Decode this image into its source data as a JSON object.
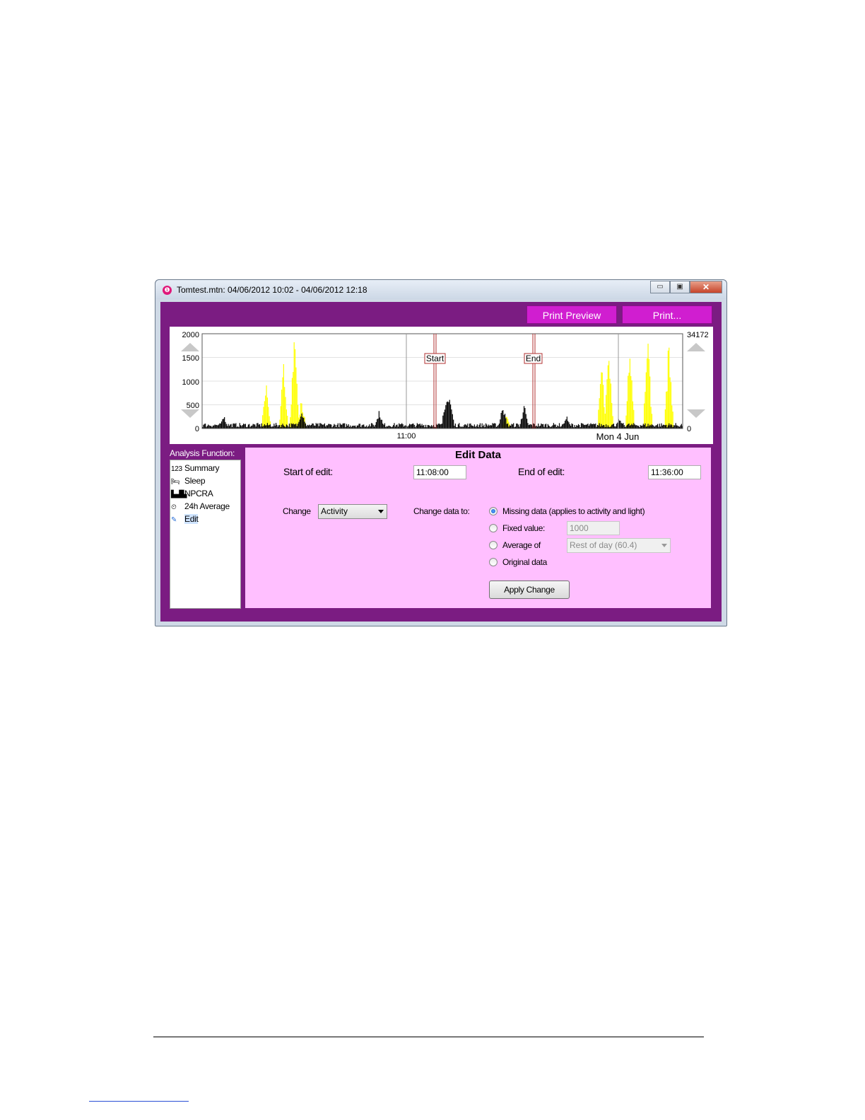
{
  "window": {
    "title": "Tomtest.mtn: 04/06/2012 10:02 - 04/06/2012 12:18",
    "buttons": {
      "minimize": "▭",
      "maximize": "▣",
      "close": "✕"
    }
  },
  "toolbar": {
    "print_preview": "Print Preview",
    "print": "Print..."
  },
  "chart": {
    "left_axis_ticks": [
      "2000",
      "1500",
      "1000",
      "500",
      "0"
    ],
    "right_axis_ticks": [
      "34172",
      "0"
    ],
    "x_tick": "11:00",
    "x_date": "Mon 4 Jun",
    "start_marker": "Start",
    "end_marker": "End",
    "colors": {
      "activity": "#000000",
      "light": "#ffff00",
      "marker": "#b03030"
    }
  },
  "chart_data": {
    "type": "bar",
    "title": "",
    "xlabel": "",
    "ylabel": "",
    "x_range": [
      "04/06/2012 10:02",
      "04/06/2012 12:18"
    ],
    "x_ticks": [
      "11:00",
      "Mon 4 Jun"
    ],
    "ylim": [
      0,
      2000
    ],
    "y2lim": [
      0,
      34172
    ],
    "grid": true,
    "markers": [
      {
        "label": "Start",
        "time": "11:08:00"
      },
      {
        "label": "End",
        "time": "11:36:00"
      }
    ],
    "series": [
      {
        "color": "#ffff00",
        "axis": "right",
        "peaks": [
          {
            "x": "10:20",
            "y": 17000
          },
          {
            "x": "10:25",
            "y": 25000
          },
          {
            "x": "10:28",
            "y": 34172
          },
          {
            "x": "10:30",
            "y": 12000
          },
          {
            "x": "11:28",
            "y": 5000
          },
          {
            "x": "11:55",
            "y": 24000
          },
          {
            "x": "11:57",
            "y": 30000
          },
          {
            "x": "12:03",
            "y": 34172
          },
          {
            "x": "12:08",
            "y": 34172
          },
          {
            "x": "12:14",
            "y": 34172
          }
        ]
      },
      {
        "color": "#000000",
        "axis": "left",
        "peaks": [
          {
            "x": "10:08",
            "y": 300
          },
          {
            "x": "10:30",
            "y": 450
          },
          {
            "x": "10:52",
            "y": 450
          },
          {
            "x": "11:11",
            "y": 900
          },
          {
            "x": "11:12",
            "y": 750
          },
          {
            "x": "11:27",
            "y": 600
          },
          {
            "x": "11:33",
            "y": 550
          },
          {
            "x": "11:45",
            "y": 300
          },
          {
            "x": "12:00",
            "y": 250
          }
        ]
      }
    ]
  },
  "sidebar": {
    "label": "Analysis Function:",
    "items": [
      {
        "icon": "123",
        "label": "Summary"
      },
      {
        "icon": "bed",
        "label": "Sleep"
      },
      {
        "icon": "wave",
        "label": "NPCRA"
      },
      {
        "icon": "clock",
        "label": "24h Average"
      },
      {
        "icon": "pencil",
        "label": "Edit"
      }
    ]
  },
  "edit": {
    "title": "Edit Data",
    "start_label": "Start of edit:",
    "start_value": "11:08:00",
    "end_label": "End of edit:",
    "end_value": "11:36:00",
    "change_label": "Change",
    "change_value": "Activity",
    "change_to_label": "Change data to:",
    "options": [
      {
        "label": "Missing data (applies to activity and light)",
        "selected": true
      },
      {
        "label": "Fixed value:",
        "selected": false
      },
      {
        "label": "Average of",
        "selected": false
      },
      {
        "label": "Original data",
        "selected": false
      }
    ],
    "fixed_value": "1000",
    "average_value": "Rest of day (60.4)",
    "apply_label": "Apply Change"
  }
}
